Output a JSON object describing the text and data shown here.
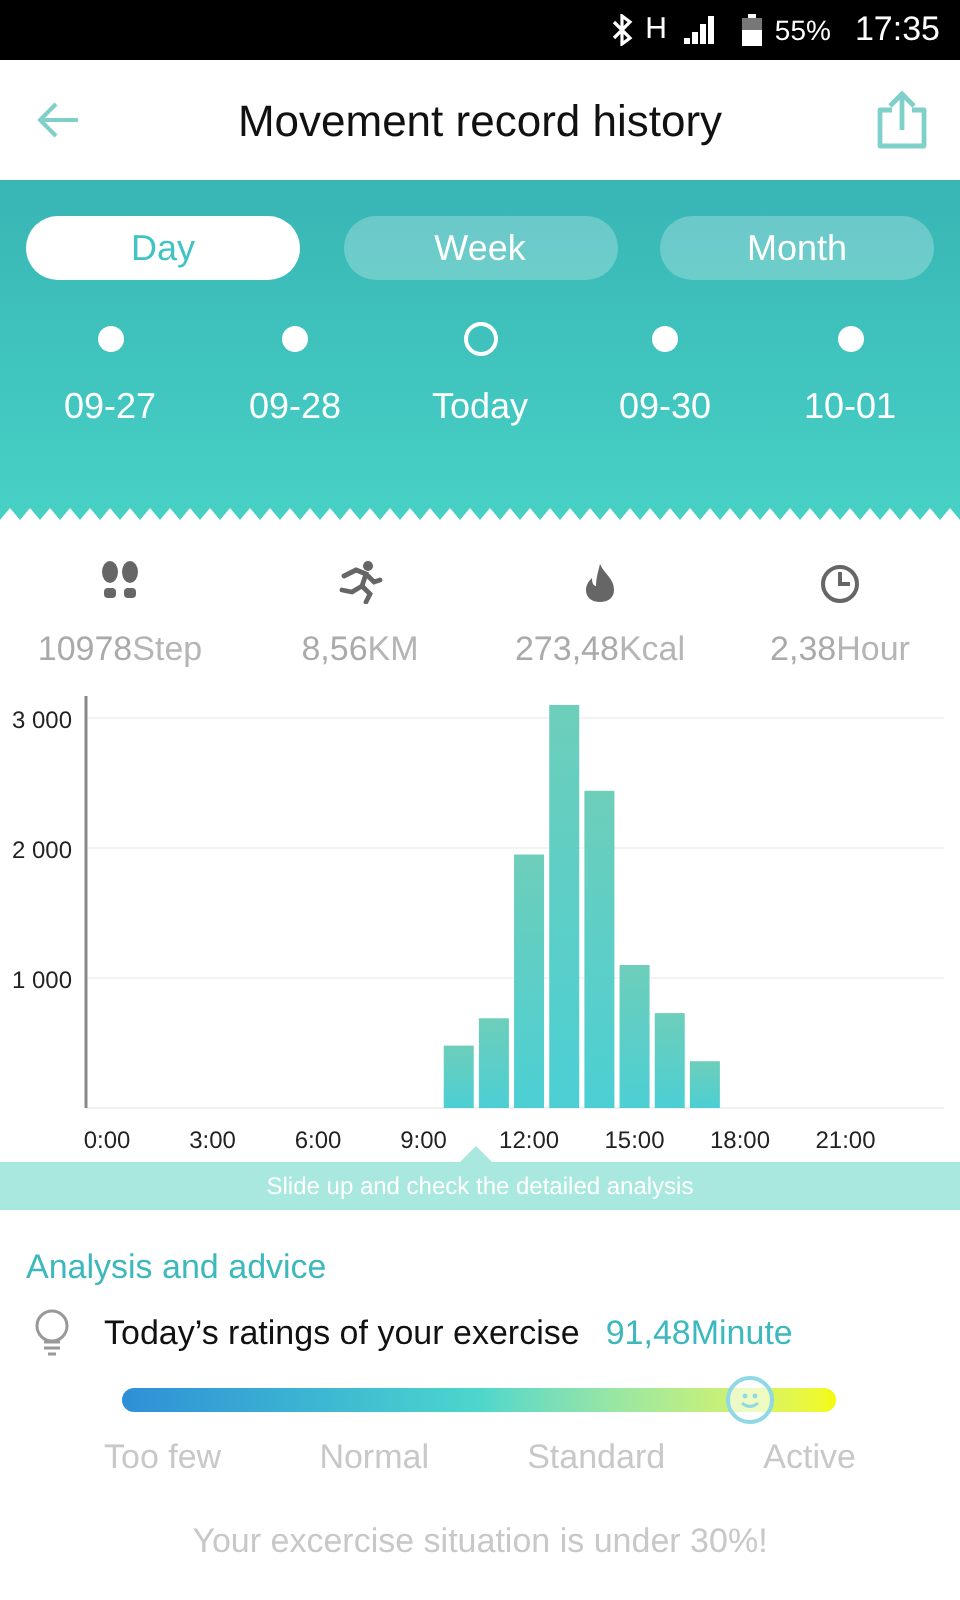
{
  "status_bar": {
    "network": "H",
    "battery": "55%",
    "time": "17:35"
  },
  "header": {
    "title": "Movement record history"
  },
  "tabs": [
    {
      "label": "Day",
      "selected": true
    },
    {
      "label": "Week",
      "selected": false
    },
    {
      "label": "Month",
      "selected": false
    }
  ],
  "dates": [
    {
      "label": "09-27",
      "selected": false
    },
    {
      "label": "09-28",
      "selected": false
    },
    {
      "label": "Today",
      "selected": true
    },
    {
      "label": "09-30",
      "selected": false
    },
    {
      "label": "10-01",
      "selected": false
    }
  ],
  "stats": [
    {
      "kind": "steps",
      "value": "10978",
      "unit": "Step"
    },
    {
      "kind": "distance",
      "value": "8,56",
      "unit": "KM"
    },
    {
      "kind": "calories",
      "value": "273,48",
      "unit": "Kcal"
    },
    {
      "kind": "duration",
      "value": "2,38",
      "unit": "Hour"
    }
  ],
  "chart": {
    "chart_data": {
      "type": "bar",
      "x": [
        10,
        11,
        12,
        13,
        14,
        15,
        16,
        17
      ],
      "series": [
        {
          "color": "#4ccfd4",
          "values": [
            480,
            690,
            1950,
            3100,
            2440,
            1100,
            730,
            360
          ]
        }
      ],
      "xlim": [
        -0.6,
        23.8
      ],
      "grid": true,
      "ylim": [
        0,
        3200
      ],
      "yticks": [
        {
          "value": 1000,
          "label": "1 000"
        },
        {
          "value": 2000,
          "label": "2 000"
        },
        {
          "value": 3000,
          "label": "3 000"
        }
      ],
      "xticks": [
        {
          "value": 0,
          "label": "0:00"
        },
        {
          "value": 3,
          "label": "3:00"
        },
        {
          "value": 6,
          "label": "6:00"
        },
        {
          "value": 9,
          "label": "9:00"
        },
        {
          "value": 12,
          "label": "12:00"
        },
        {
          "value": 15,
          "label": "15:00"
        },
        {
          "value": 18,
          "label": "18:00"
        },
        {
          "value": 21,
          "label": "21:00"
        }
      ]
    }
  },
  "hint": "Slide up and check the detailed analysis",
  "analysis": {
    "heading": "Analysis and advice",
    "rating_label": "Today’s ratings of your exercise",
    "rating_value": "91,48Minute",
    "scale": {
      "level": 0.88,
      "labels": [
        "Too few",
        "Normal",
        "Standard",
        "Active"
      ]
    },
    "message": "Your excercise situation is under 30%!"
  }
}
